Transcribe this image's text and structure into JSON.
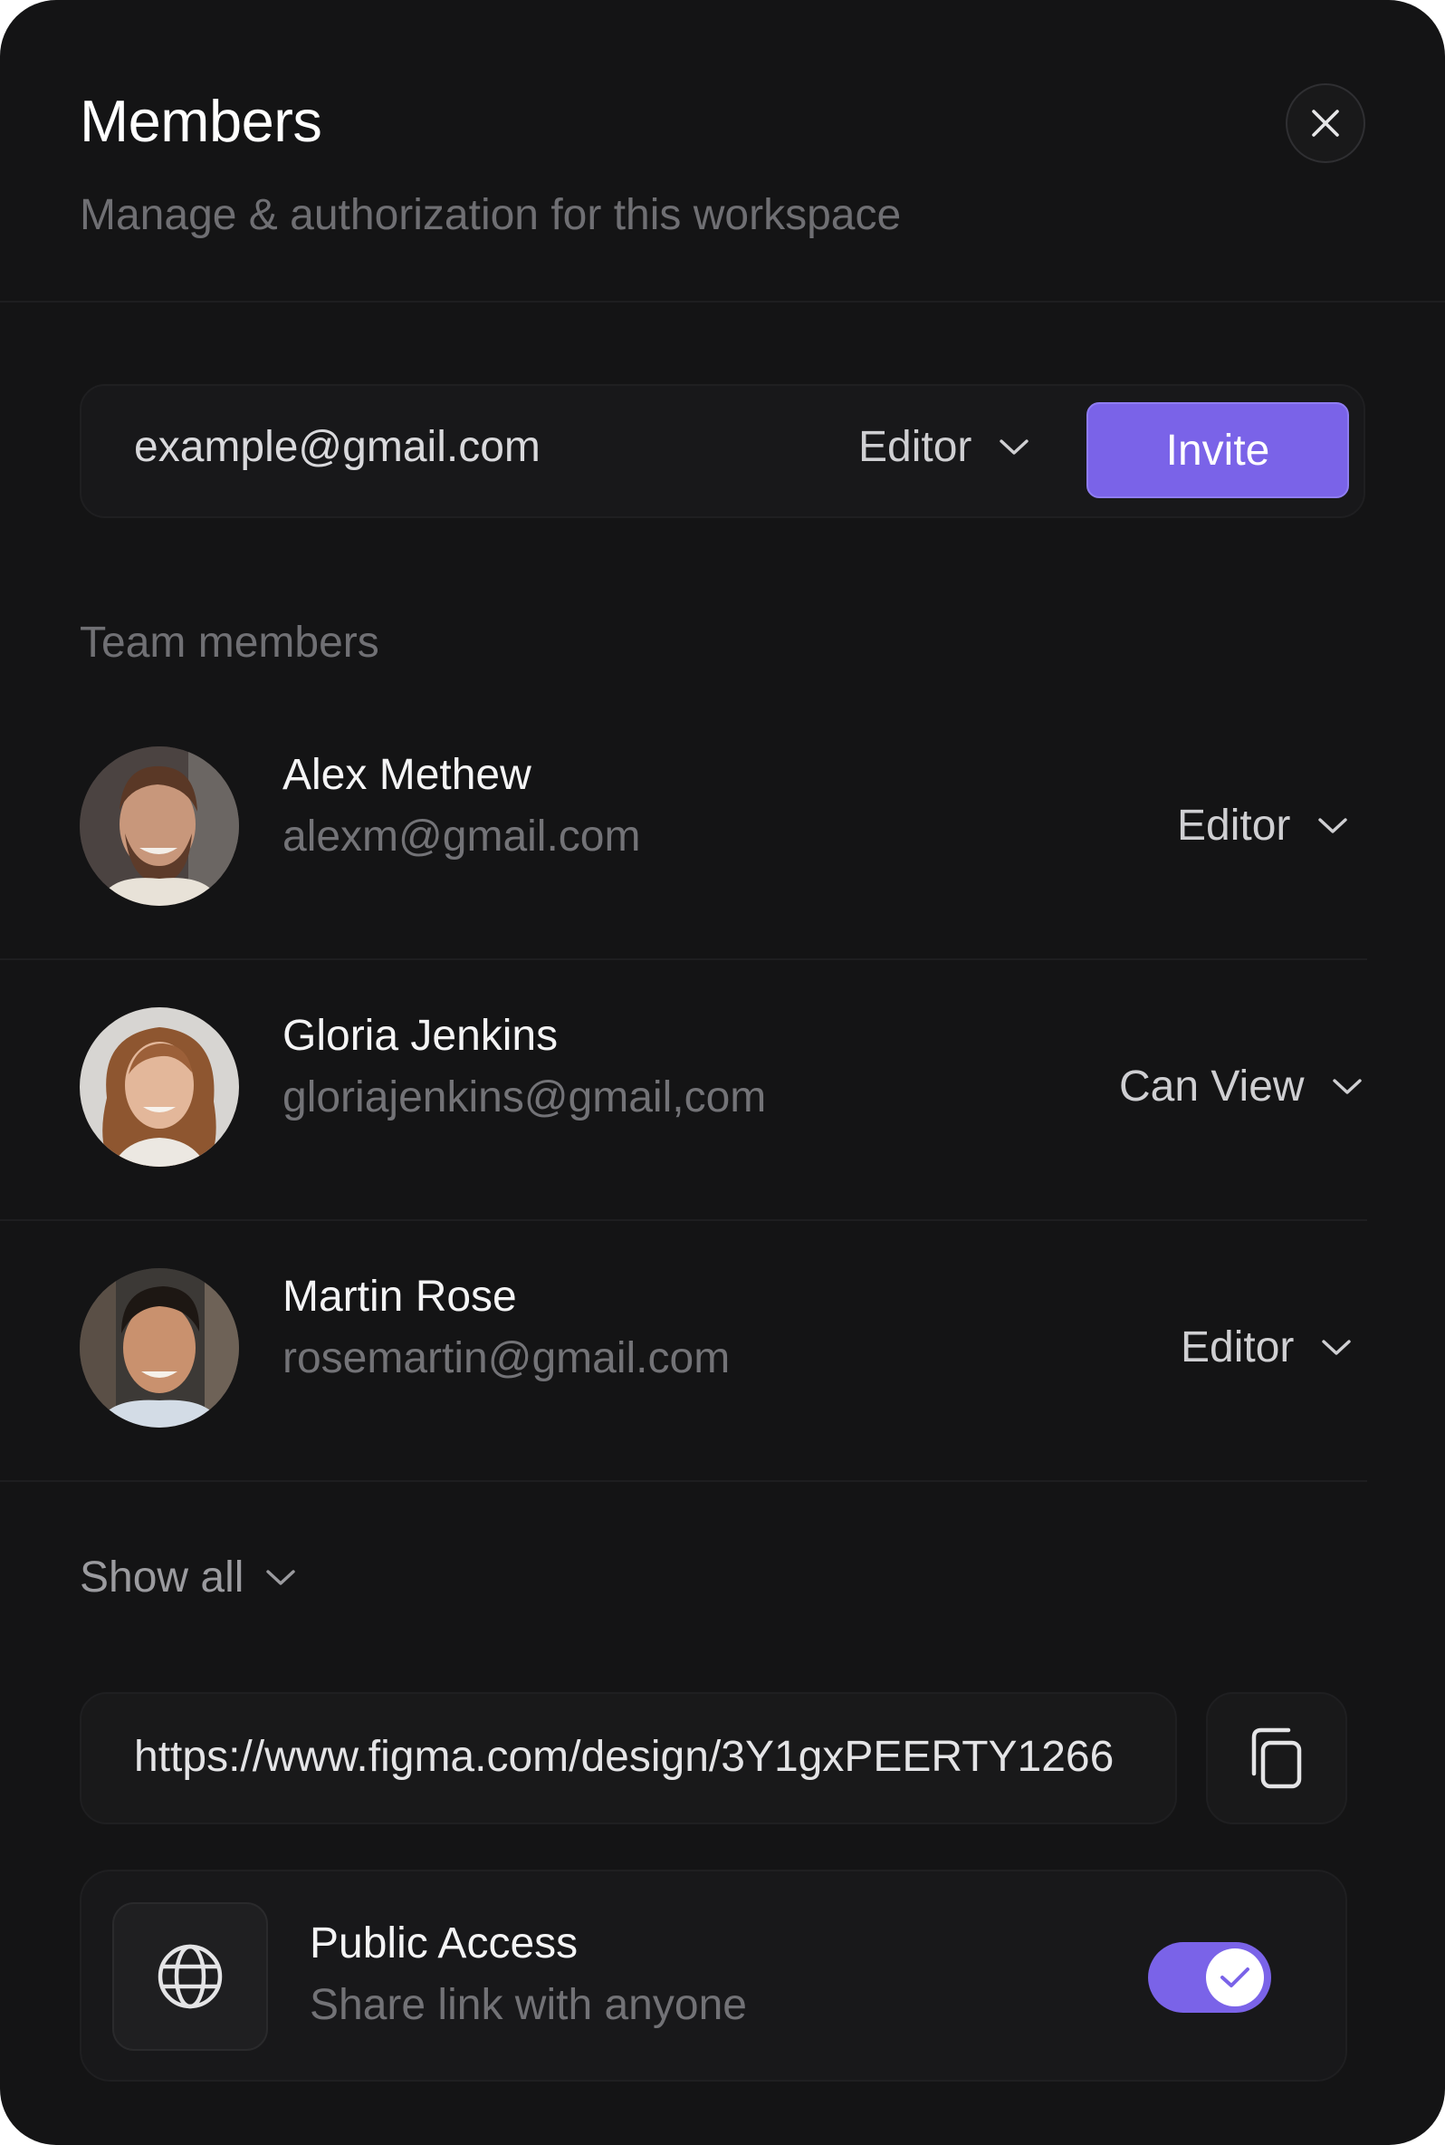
{
  "header": {
    "title": "Members",
    "subtitle": "Manage & authorization for this workspace",
    "close_icon": "close-icon"
  },
  "invite": {
    "email_value": "example@gmail.com",
    "role": "Editor",
    "button_label": "Invite"
  },
  "team": {
    "section_label": "Team members",
    "members": [
      {
        "name": "Alex Methew",
        "email": "alexm@gmail.com",
        "role": "Editor"
      },
      {
        "name": "Gloria Jenkins",
        "email": "gloriajenkins@gmail,com",
        "role": "Can View"
      },
      {
        "name": "Martin Rose",
        "email": "rosemartin@gmail.com",
        "role": "Editor"
      }
    ],
    "show_all_label": "Show all"
  },
  "share": {
    "link": "https://www.figma.com/design/3Y1gxPEERTY1266",
    "copy_icon": "copy-icon",
    "public_access_title": "Public Access",
    "public_access_subtitle": "Share link with anyone",
    "public_access_enabled": true
  },
  "colors": {
    "background": "#141415",
    "accent": "#7a63e8",
    "text_primary": "#f4f4f5",
    "text_muted": "#737377"
  }
}
